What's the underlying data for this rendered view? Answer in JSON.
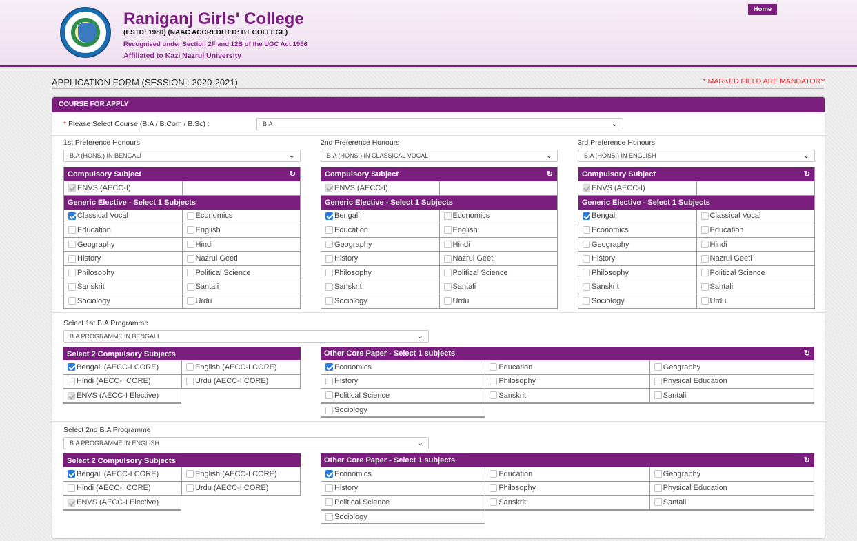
{
  "header": {
    "college_name": "Raniganj Girls' College",
    "estd": "(ESTD: 1980) (NAAC ACCREDITED: B+ COLLEGE)",
    "recognised": "Recognised under Section 2F and 12B of the UGC Act 1956",
    "affiliated": "Affiliated to Kazi Nazrul University",
    "home_label": "Home",
    "logo_icon": "college-seal-icon"
  },
  "page": {
    "title": "APPLICATION FORM (SESSION : 2020-2021)",
    "mandatory_note": "* MARKED FIELD ARE MANDATORY"
  },
  "course": {
    "panel_title": "COURSE FOR APPLY",
    "select_label": "Please Select Course (B.A / B.Com / B.Sc) :",
    "required_mark": "*",
    "selected": "B.A"
  },
  "preferences": [
    {
      "label": "1st Preference Honours",
      "selected": "B.A (HONS.) IN BENGALI",
      "compulsory_head": "Compulsory Subject",
      "compulsory": "ENVS (AECC-I)",
      "generic_head": "Generic Elective - Select 1 Subjects",
      "subjects": [
        {
          "name": "Classical Vocal",
          "checked": true
        },
        {
          "name": "Economics",
          "checked": false
        },
        {
          "name": "Education",
          "checked": false
        },
        {
          "name": "English",
          "checked": false
        },
        {
          "name": "Geography",
          "checked": false
        },
        {
          "name": "Hindi",
          "checked": false
        },
        {
          "name": "History",
          "checked": false
        },
        {
          "name": "Nazrul Geeti",
          "checked": false
        },
        {
          "name": "Philosophy",
          "checked": false
        },
        {
          "name": "Political Science",
          "checked": false
        },
        {
          "name": "Sanskrit",
          "checked": false
        },
        {
          "name": "Santali",
          "checked": false
        },
        {
          "name": "Sociology",
          "checked": false
        },
        {
          "name": "Urdu",
          "checked": false
        }
      ]
    },
    {
      "label": "2nd Preference Honours",
      "selected": "B.A (HONS.) IN CLASSICAL VOCAL",
      "compulsory_head": "Compulsory Subject",
      "compulsory": "ENVS (AECC-I)",
      "generic_head": "Generic Elective - Select 1 Subjects",
      "subjects": [
        {
          "name": "Bengali",
          "checked": true
        },
        {
          "name": "Economics",
          "checked": false
        },
        {
          "name": "Education",
          "checked": false
        },
        {
          "name": "English",
          "checked": false
        },
        {
          "name": "Geography",
          "checked": false
        },
        {
          "name": "Hindi",
          "checked": false
        },
        {
          "name": "History",
          "checked": false
        },
        {
          "name": "Nazrul Geeti",
          "checked": false
        },
        {
          "name": "Philosophy",
          "checked": false
        },
        {
          "name": "Political Science",
          "checked": false
        },
        {
          "name": "Sanskrit",
          "checked": false
        },
        {
          "name": "Santali",
          "checked": false
        },
        {
          "name": "Sociology",
          "checked": false
        },
        {
          "name": "Urdu",
          "checked": false
        }
      ]
    },
    {
      "label": "3rd Preference Honours",
      "selected": "B.A (HONS.) IN ENGLISH",
      "compulsory_head": "Compulsory Subject",
      "compulsory": "ENVS (AECC-I)",
      "generic_head": "Generic Elective - Select 1 Subjects",
      "subjects": [
        {
          "name": "Bengali",
          "checked": true
        },
        {
          "name": "Classical Vocal",
          "checked": false
        },
        {
          "name": "Economics",
          "checked": false
        },
        {
          "name": "Education",
          "checked": false
        },
        {
          "name": "Geography",
          "checked": false
        },
        {
          "name": "Hindi",
          "checked": false
        },
        {
          "name": "History",
          "checked": false
        },
        {
          "name": "Nazrul Geeti",
          "checked": false
        },
        {
          "name": "Philosophy",
          "checked": false
        },
        {
          "name": "Political Science",
          "checked": false
        },
        {
          "name": "Sanskrit",
          "checked": false
        },
        {
          "name": "Santali",
          "checked": false
        },
        {
          "name": "Sociology",
          "checked": false
        },
        {
          "name": "Urdu",
          "checked": false
        }
      ]
    }
  ],
  "programmes": [
    {
      "label": "Select 1st B.A Programme",
      "selected": "B.A PROGRAMME IN BENGALI",
      "compulsory_head": "Select 2 Compulsory Subjects",
      "compulsory": [
        {
          "name": "Bengali (AECC-I CORE)",
          "state": "checked"
        },
        {
          "name": "English (AECC-I CORE)",
          "state": "unchecked"
        },
        {
          "name": "Hindi (AECC-I CORE)",
          "state": "unchecked"
        },
        {
          "name": "Urdu (AECC-I CORE)",
          "state": "unchecked"
        },
        {
          "name": "ENVS (AECC-I Elective)",
          "state": "disabled"
        }
      ],
      "core_head": "Other Core Paper - Select 1 subjects",
      "core": [
        {
          "name": "Economics",
          "checked": true
        },
        {
          "name": "Education",
          "checked": false
        },
        {
          "name": "Geography",
          "checked": false
        },
        {
          "name": "History",
          "checked": false
        },
        {
          "name": "Philosophy",
          "checked": false
        },
        {
          "name": "Physical Education",
          "checked": false
        },
        {
          "name": "Political Science",
          "checked": false
        },
        {
          "name": "Sanskrit",
          "checked": false
        },
        {
          "name": "Santali",
          "checked": false
        },
        {
          "name": "Sociology",
          "checked": false
        }
      ]
    },
    {
      "label": "Select 2nd B.A Programme",
      "selected": "B.A PROGRAMME IN ENGLISH",
      "compulsory_head": "Select 2 Compulsory Subjects",
      "compulsory": [
        {
          "name": "Bengali (AECC-I CORE)",
          "state": "checked"
        },
        {
          "name": "English (AECC-I CORE)",
          "state": "unchecked"
        },
        {
          "name": "Hindi (AECC-I CORE)",
          "state": "unchecked"
        },
        {
          "name": "Urdu (AECC-I CORE)",
          "state": "unchecked"
        },
        {
          "name": "ENVS (AECC-I Elective)",
          "state": "disabled"
        }
      ],
      "core_head": "Other Core Paper - Select 1 subjects",
      "core": [
        {
          "name": "Economics",
          "checked": true
        },
        {
          "name": "Education",
          "checked": false
        },
        {
          "name": "Geography",
          "checked": false
        },
        {
          "name": "History",
          "checked": false
        },
        {
          "name": "Philosophy",
          "checked": false
        },
        {
          "name": "Physical Education",
          "checked": false
        },
        {
          "name": "Political Science",
          "checked": false
        },
        {
          "name": "Sanskrit",
          "checked": false
        },
        {
          "name": "Santali",
          "checked": false
        },
        {
          "name": "Sociology",
          "checked": false
        }
      ]
    }
  ],
  "icons": {
    "refresh": "refresh-icon",
    "chevron": "chevron-down-icon"
  },
  "colors": {
    "brand": "#7a1e7e",
    "required": "#d8262c",
    "checkbox": "#2a7bd9"
  }
}
